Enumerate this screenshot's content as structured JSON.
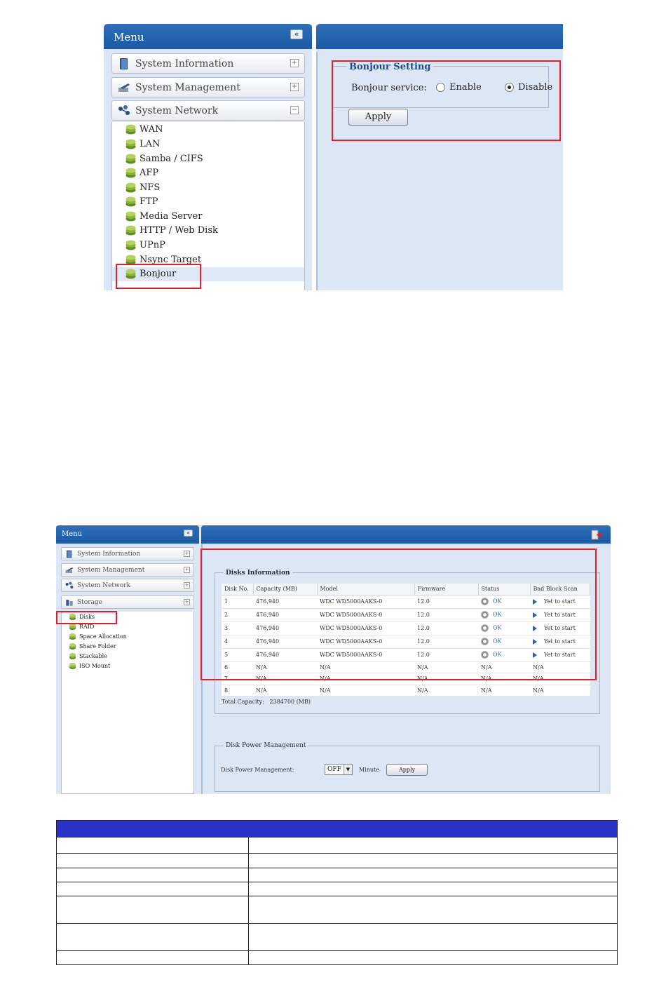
{
  "shot1": {
    "menu_title": "Menu",
    "collapse": "«",
    "categories": [
      {
        "label": "System Information",
        "toggle": "+"
      },
      {
        "label": "System Management",
        "toggle": "+"
      },
      {
        "label": "System Network",
        "toggle": "−"
      }
    ],
    "network_items": [
      "WAN",
      "LAN",
      "Samba / CIFS",
      "AFP",
      "NFS",
      "FTP",
      "Media Server",
      "HTTP / Web Disk",
      "UPnP",
      "Nsync Target",
      "Bonjour"
    ],
    "selected_item": "Bonjour",
    "bonjour": {
      "legend": "Bonjour Setting",
      "service_label": "Bonjour service:",
      "enable_label": "Enable",
      "disable_label": "Disable",
      "selected": "Disable",
      "apply_label": "Apply"
    }
  },
  "shot2": {
    "menu_title": "Menu",
    "collapse": "«",
    "categories": [
      {
        "label": "System Information",
        "toggle": "+"
      },
      {
        "label": "System Management",
        "toggle": "+"
      },
      {
        "label": "System Network",
        "toggle": "+"
      },
      {
        "label": "Storage",
        "toggle": "+"
      }
    ],
    "storage_items": [
      "Disks",
      "RAID",
      "Space Allocation",
      "Share Folder",
      "Stackable",
      "ISO Mount"
    ],
    "disks": {
      "legend": "Disks Information",
      "columns": [
        "Disk No.",
        "Capacity (MB)",
        "Model",
        "Firmware",
        "Status",
        "Bad Block Scan"
      ],
      "rows": [
        {
          "no": "1",
          "capacity": "476,940",
          "model": "WDC WD5000AAKS-0",
          "firmware": "12.0",
          "status": "OK",
          "scan": "Yet to start"
        },
        {
          "no": "2",
          "capacity": "476,940",
          "model": "WDC WD5000AAKS-0",
          "firmware": "12.0",
          "status": "OK",
          "scan": "Yet to start"
        },
        {
          "no": "3",
          "capacity": "476,940",
          "model": "WDC WD5000AAKS-0",
          "firmware": "12.0",
          "status": "OK",
          "scan": "Yet to start"
        },
        {
          "no": "4",
          "capacity": "476,940",
          "model": "WDC WD5000AAKS-0",
          "firmware": "12.0",
          "status": "OK",
          "scan": "Yet to start"
        },
        {
          "no": "5",
          "capacity": "476,940",
          "model": "WDC WD5000AAKS-0",
          "firmware": "12.0",
          "status": "OK",
          "scan": "Yet to start"
        }
      ],
      "na_rows": [
        {
          "no": "6",
          "value": "N/A"
        },
        {
          "no": "7",
          "value": "N/A"
        },
        {
          "no": "8",
          "value": "N/A"
        }
      ],
      "total_label": "Total Capacity:",
      "total_value": "2384700 (MB)"
    },
    "power": {
      "legend": "Disk Power Management",
      "label": "Disk Power Management:",
      "select_value": "OFF",
      "minute_label": "Minute",
      "apply_label": "Apply"
    }
  },
  "colors": {
    "header_blue": "#1a5aa6",
    "panel_bg": "#dde6f5",
    "highlight_red": "#e0202a",
    "table_header": "#2a32c8"
  },
  "bottom_table": {
    "rows": 9
  }
}
